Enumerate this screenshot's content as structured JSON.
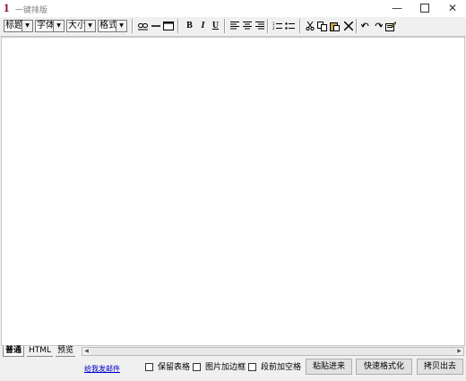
{
  "window": {
    "app_icon_text": "1",
    "title": "一键排版",
    "minimize_glyph": "—",
    "close_glyph": "✕"
  },
  "toolbar": {
    "selects": [
      {
        "label": "标题"
      },
      {
        "label": "字体"
      },
      {
        "label": "大小"
      },
      {
        "label": "格式"
      }
    ],
    "bold": "B",
    "italic": "I",
    "underline": "U",
    "icons": [
      "link-icon",
      "horizontal-rule-icon",
      "table-icon",
      "bold-icon",
      "italic-icon",
      "underline-icon",
      "align-left-icon",
      "align-center-icon",
      "align-right-icon",
      "numbered-list-icon",
      "bullet-list-icon",
      "cut-icon",
      "copy-icon",
      "paste-icon",
      "delete-icon",
      "undo-icon",
      "redo-icon",
      "edit-html-icon"
    ]
  },
  "tabs": [
    {
      "label": "普通"
    },
    {
      "label": "HTML"
    },
    {
      "label": "预览"
    }
  ],
  "bottom": {
    "link_text": "给我发邮件",
    "checkboxes": [
      {
        "label": "保留表格",
        "checked": false
      },
      {
        "label": "图片加边框",
        "checked": false
      },
      {
        "label": "段前加空格",
        "checked": false
      }
    ],
    "buttons": [
      {
        "label": "粘贴进来"
      },
      {
        "label": "快速格式化"
      },
      {
        "label": "拷贝出去"
      }
    ]
  }
}
